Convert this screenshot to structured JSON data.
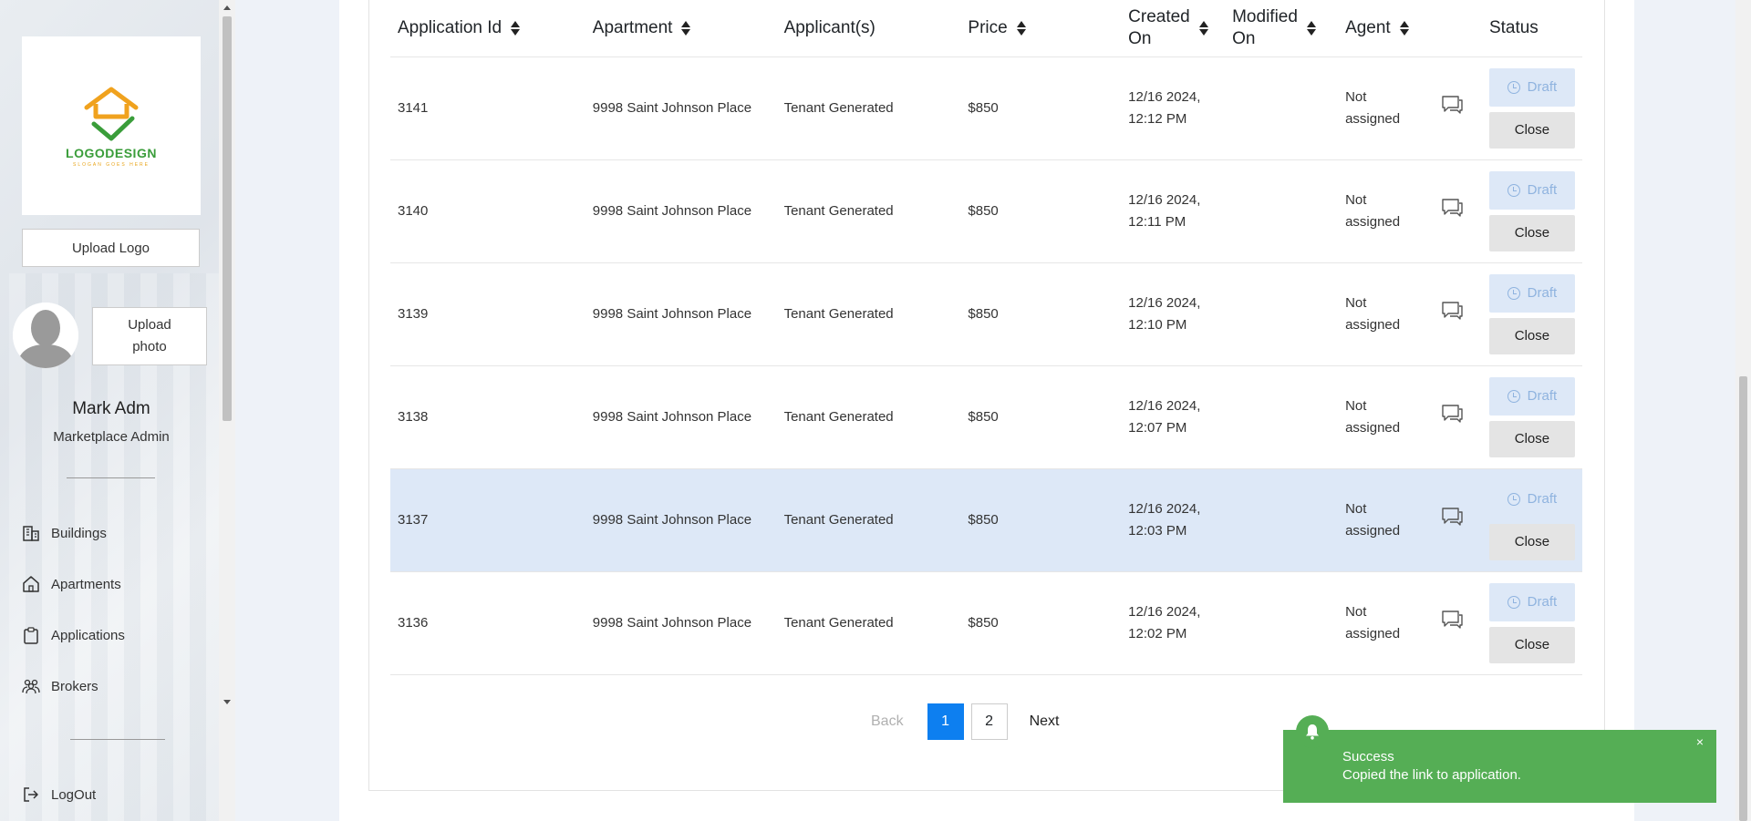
{
  "sidebar": {
    "logo": {
      "title": "LOGODESIGN",
      "slogan": "SLOGAN GOES HERE"
    },
    "upload_logo_label": "Upload Logo",
    "upload_photo_label": "Upload photo",
    "user_name": "Mark Adm",
    "user_role": "Marketplace Admin",
    "nav": [
      {
        "label": "Buildings",
        "icon": "building-icon"
      },
      {
        "label": "Apartments",
        "icon": "home-icon"
      },
      {
        "label": "Applications",
        "icon": "clipboard-icon"
      },
      {
        "label": "Brokers",
        "icon": "users-icon"
      }
    ],
    "logout_label": "LogOut"
  },
  "table": {
    "headers": {
      "application_id": "Application Id",
      "apartment": "Apartment",
      "applicants": "Applicant(s)",
      "price": "Price",
      "created_on_1": "Created",
      "created_on_2": "On",
      "modified_on_1": "Modified",
      "modified_on_2": "On",
      "agent": "Agent",
      "status": "Status"
    },
    "rows": [
      {
        "id": "3141",
        "apartment": "9998 Saint Johnson Place",
        "applicants": "Tenant Generated",
        "price": "$850",
        "created_date": "12/16 2024,",
        "created_time": "12:12 PM",
        "agent_1": "Not",
        "agent_2": "assigned",
        "status": "Draft",
        "action": "Close"
      },
      {
        "id": "3140",
        "apartment": "9998 Saint Johnson Place",
        "applicants": "Tenant Generated",
        "price": "$850",
        "created_date": "12/16 2024,",
        "created_time": "12:11 PM",
        "agent_1": "Not",
        "agent_2": "assigned",
        "status": "Draft",
        "action": "Close"
      },
      {
        "id": "3139",
        "apartment": "9998 Saint Johnson Place",
        "applicants": "Tenant Generated",
        "price": "$850",
        "created_date": "12/16 2024,",
        "created_time": "12:10 PM",
        "agent_1": "Not",
        "agent_2": "assigned",
        "status": "Draft",
        "action": "Close"
      },
      {
        "id": "3138",
        "apartment": "9998 Saint Johnson Place",
        "applicants": "Tenant Generated",
        "price": "$850",
        "created_date": "12/16 2024,",
        "created_time": "12:07 PM",
        "agent_1": "Not",
        "agent_2": "assigned",
        "status": "Draft",
        "action": "Close"
      },
      {
        "id": "3137",
        "apartment": "9998 Saint Johnson Place",
        "applicants": "Tenant Generated",
        "price": "$850",
        "created_date": "12/16 2024,",
        "created_time": "12:03 PM",
        "agent_1": "Not",
        "agent_2": "assigned",
        "status": "Draft",
        "action": "Close"
      },
      {
        "id": "3136",
        "apartment": "9998 Saint Johnson Place",
        "applicants": "Tenant Generated",
        "price": "$850",
        "created_date": "12/16 2024,",
        "created_time": "12:02 PM",
        "agent_1": "Not",
        "agent_2": "assigned",
        "status": "Draft",
        "action": "Close"
      }
    ],
    "highlighted_row_index": 4
  },
  "pagination": {
    "back_label": "Back",
    "pages": [
      "1",
      "2"
    ],
    "current_page": "1",
    "next_label": "Next"
  },
  "toast": {
    "title": "Success",
    "message": "Copied the link to application.",
    "close_glyph": "×"
  },
  "colors": {
    "accent": "#0d7ff0",
    "toast_bg": "#55ae55",
    "highlight_row": "#dde8f7",
    "draft_text": "#8fb3df"
  }
}
